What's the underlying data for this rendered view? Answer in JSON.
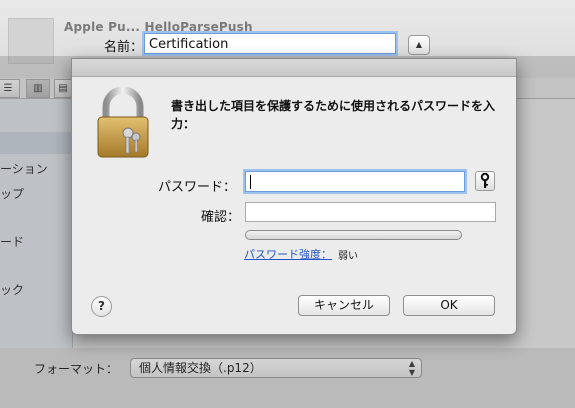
{
  "background": {
    "ghost_title": "Apple Pu... HelloParsePush",
    "name_label": "名前：",
    "name_value": "Certification",
    "sidebar_items": [
      "ーション",
      "ップ",
      "ード",
      "ック"
    ],
    "format_label": "フォーマット：",
    "format_value": "個人情報交換（.p12）"
  },
  "dialog": {
    "prompt": "書き出した項目を保護するために使用されるパスワードを入力：",
    "password_label": "パスワード：",
    "password_value": "",
    "confirm_label": "確認：",
    "confirm_value": "",
    "strength_label": "パスワード強度：",
    "strength_value": "弱い",
    "strength_level": 0,
    "help_label": "?",
    "cancel_label": "キャンセル",
    "ok_label": "OK"
  },
  "icons": {
    "lock": "lock-icon",
    "key": "key-icon",
    "help": "help-icon"
  },
  "colors": {
    "focus_ring": "#9cc2f0",
    "link": "#2354c9",
    "lock_body": "#c9a24a"
  }
}
